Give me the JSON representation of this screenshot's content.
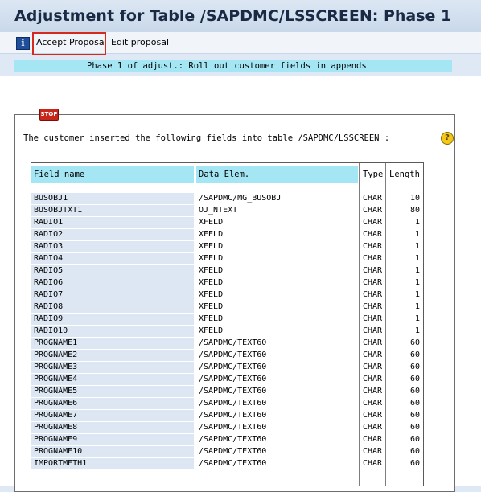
{
  "window": {
    "title": "Adjustment for Table /SAPDMC/LSSCREEN: Phase 1"
  },
  "toolbar": {
    "info_icon": "info-icon",
    "accept_label": "Accept Proposal",
    "edit_label": "Edit proposal"
  },
  "phase_banner": "Phase 1 of adjust.: Roll out customer fields in appends",
  "message": {
    "stop_label": "STOP",
    "text": "The customer inserted the following fields into table /SAPDMC/LSSCREEN :",
    "help_glyph": "?"
  },
  "table": {
    "headers": [
      "Field name",
      "Data Elem.",
      "Type",
      "Length"
    ],
    "rows": [
      {
        "field": "BUSOBJ1",
        "elem": "/SAPDMC/MG_BUSOBJ",
        "type": "CHAR",
        "length": "10"
      },
      {
        "field": "BUSOBJTXT1",
        "elem": "OJ_NTEXT",
        "type": "CHAR",
        "length": "80"
      },
      {
        "field": "RADIO1",
        "elem": "XFELD",
        "type": "CHAR",
        "length": "1"
      },
      {
        "field": "RADIO2",
        "elem": "XFELD",
        "type": "CHAR",
        "length": "1"
      },
      {
        "field": "RADIO3",
        "elem": "XFELD",
        "type": "CHAR",
        "length": "1"
      },
      {
        "field": "RADIO4",
        "elem": "XFELD",
        "type": "CHAR",
        "length": "1"
      },
      {
        "field": "RADIO5",
        "elem": "XFELD",
        "type": "CHAR",
        "length": "1"
      },
      {
        "field": "RADIO6",
        "elem": "XFELD",
        "type": "CHAR",
        "length": "1"
      },
      {
        "field": "RADIO7",
        "elem": "XFELD",
        "type": "CHAR",
        "length": "1"
      },
      {
        "field": "RADIO8",
        "elem": "XFELD",
        "type": "CHAR",
        "length": "1"
      },
      {
        "field": "RADIO9",
        "elem": "XFELD",
        "type": "CHAR",
        "length": "1"
      },
      {
        "field": "RADIO10",
        "elem": "XFELD",
        "type": "CHAR",
        "length": "1"
      },
      {
        "field": "PROGNAME1",
        "elem": "/SAPDMC/TEXT60",
        "type": "CHAR",
        "length": "60"
      },
      {
        "field": "PROGNAME2",
        "elem": "/SAPDMC/TEXT60",
        "type": "CHAR",
        "length": "60"
      },
      {
        "field": "PROGNAME3",
        "elem": "/SAPDMC/TEXT60",
        "type": "CHAR",
        "length": "60"
      },
      {
        "field": "PROGNAME4",
        "elem": "/SAPDMC/TEXT60",
        "type": "CHAR",
        "length": "60"
      },
      {
        "field": "PROGNAME5",
        "elem": "/SAPDMC/TEXT60",
        "type": "CHAR",
        "length": "60"
      },
      {
        "field": "PROGNAME6",
        "elem": "/SAPDMC/TEXT60",
        "type": "CHAR",
        "length": "60"
      },
      {
        "field": "PROGNAME7",
        "elem": "/SAPDMC/TEXT60",
        "type": "CHAR",
        "length": "60"
      },
      {
        "field": "PROGNAME8",
        "elem": "/SAPDMC/TEXT60",
        "type": "CHAR",
        "length": "60"
      },
      {
        "field": "PROGNAME9",
        "elem": "/SAPDMC/TEXT60",
        "type": "CHAR",
        "length": "60"
      },
      {
        "field": "PROGNAME10",
        "elem": "/SAPDMC/TEXT60",
        "type": "CHAR",
        "length": "60"
      },
      {
        "field": "IMPORTMETH1",
        "elem": "/SAPDMC/TEXT60",
        "type": "CHAR",
        "length": "60"
      }
    ]
  },
  "colors": {
    "accent_blue": "#a5e6f4",
    "highlight_red": "#d42b1e",
    "field_cell": "#dce7f3"
  }
}
